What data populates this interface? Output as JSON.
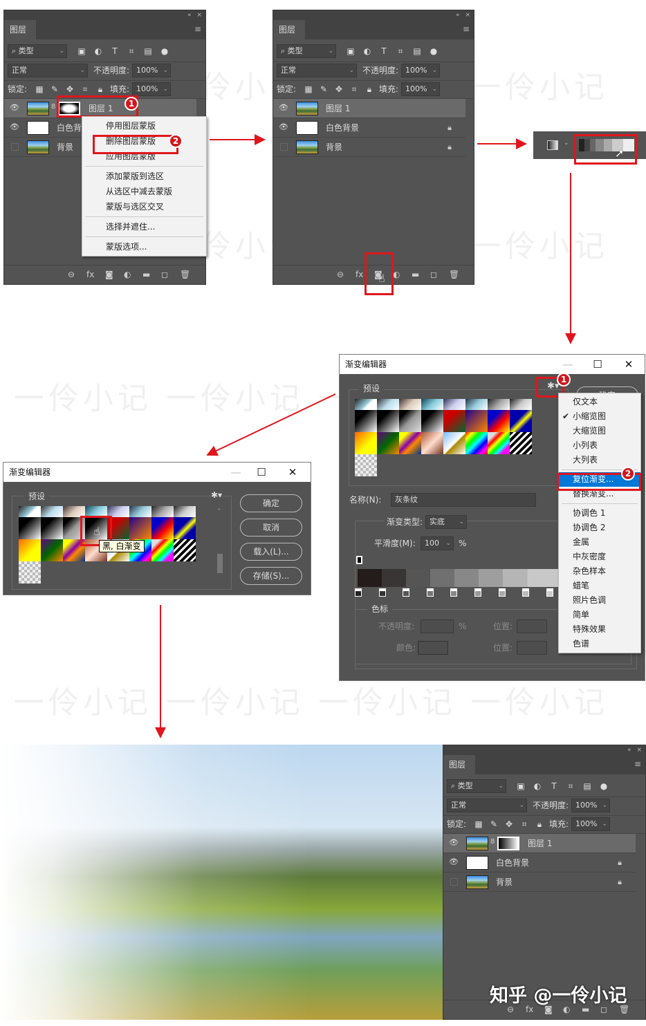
{
  "watermark": "一伶小记",
  "signature": "知乎 @一伶小记",
  "panel_common": {
    "tab": "图层",
    "collapse_icon": "«",
    "close_icon": "×",
    "menu_icon": "≡",
    "filter_label": "类型",
    "blend_mode": "正常",
    "opacity_label": "不透明度:",
    "opacity_value": "100%",
    "lock_label": "锁定:",
    "fill_label": "填充:",
    "fill_value": "100%"
  },
  "panel_a": {
    "layers": [
      {
        "name": "图层 1",
        "visible": true,
        "thumb": "photo",
        "mask": "mask1",
        "selected": true,
        "locked": false
      },
      {
        "name": "白色背景",
        "visible": true,
        "thumb": "white",
        "selected": false,
        "locked": true
      },
      {
        "name": "背景",
        "visible": false,
        "thumb": "photo",
        "selected": false,
        "locked": true
      }
    ],
    "context_menu": [
      [
        "停用图层蒙版",
        "删除图层蒙版",
        "应用图层蒙版"
      ],
      [
        "添加蒙版到选区",
        "从选区中减去蒙版",
        "蒙版与选区交叉"
      ],
      [
        "选择并遮住..."
      ],
      [
        "蒙版选项..."
      ]
    ],
    "badges": [
      "1",
      "2"
    ]
  },
  "panel_b": {
    "layers": [
      {
        "name": "图层 1",
        "visible": true,
        "thumb": "photo",
        "selected": true,
        "locked": false
      },
      {
        "name": "白色背景",
        "visible": true,
        "thumb": "white",
        "selected": false,
        "locked": true
      },
      {
        "name": "背景",
        "visible": false,
        "thumb": "photo",
        "selected": false,
        "locked": true
      }
    ]
  },
  "panel_c": {
    "layers": [
      {
        "name": "图层 1",
        "visible": true,
        "thumb": "photo",
        "mask": "mask2",
        "selected": true,
        "locked": false
      },
      {
        "name": "白色背景",
        "visible": true,
        "thumb": "white",
        "selected": false,
        "locked": true
      },
      {
        "name": "背景",
        "visible": false,
        "thumb": "photo",
        "selected": false,
        "locked": true
      }
    ]
  },
  "gradient_editor_large": {
    "title": "渐变编辑器",
    "presets_label": "预设",
    "ok_button": "确定",
    "name_label": "名称(N):",
    "name_value": "灰条纹",
    "type_label": "渐变类型:",
    "type_value": "实底",
    "smooth_label": "平滑度(M):",
    "smooth_value": "100",
    "percent": "%",
    "stops_label": "色标",
    "stop_opacity_label": "不透明度:",
    "stop_color_label": "颜色:",
    "position_label": "位置:",
    "badges": [
      "1",
      "2"
    ],
    "menu": [
      {
        "label": "仅文本"
      },
      {
        "label": "小缩览图",
        "checked": true
      },
      {
        "label": "大缩览图"
      },
      {
        "label": "小列表"
      },
      {
        "label": "大列表"
      },
      {
        "sep": true
      },
      {
        "label": "复位渐变...",
        "highlighted": true
      },
      {
        "label": "替换渐变..."
      },
      {
        "sep": true
      },
      {
        "label": "协调色 1"
      },
      {
        "label": "协调色 2"
      },
      {
        "label": "金属"
      },
      {
        "label": "中灰密度"
      },
      {
        "label": "杂色样本"
      },
      {
        "label": "蜡笔"
      },
      {
        "label": "照片色调"
      },
      {
        "label": "简单"
      },
      {
        "label": "特殊效果"
      },
      {
        "label": "色谱"
      }
    ]
  },
  "gradient_editor_small": {
    "title": "渐变编辑器",
    "presets_label": "预设",
    "tooltip": "黑, 白渐变",
    "buttons": [
      "确定",
      "取消",
      "载入(L)...",
      "存储(S)..."
    ]
  },
  "colors": {
    "accent_red": "#e0161c",
    "menu_highlight": "#0078d7",
    "panel_bg": "#535353"
  }
}
